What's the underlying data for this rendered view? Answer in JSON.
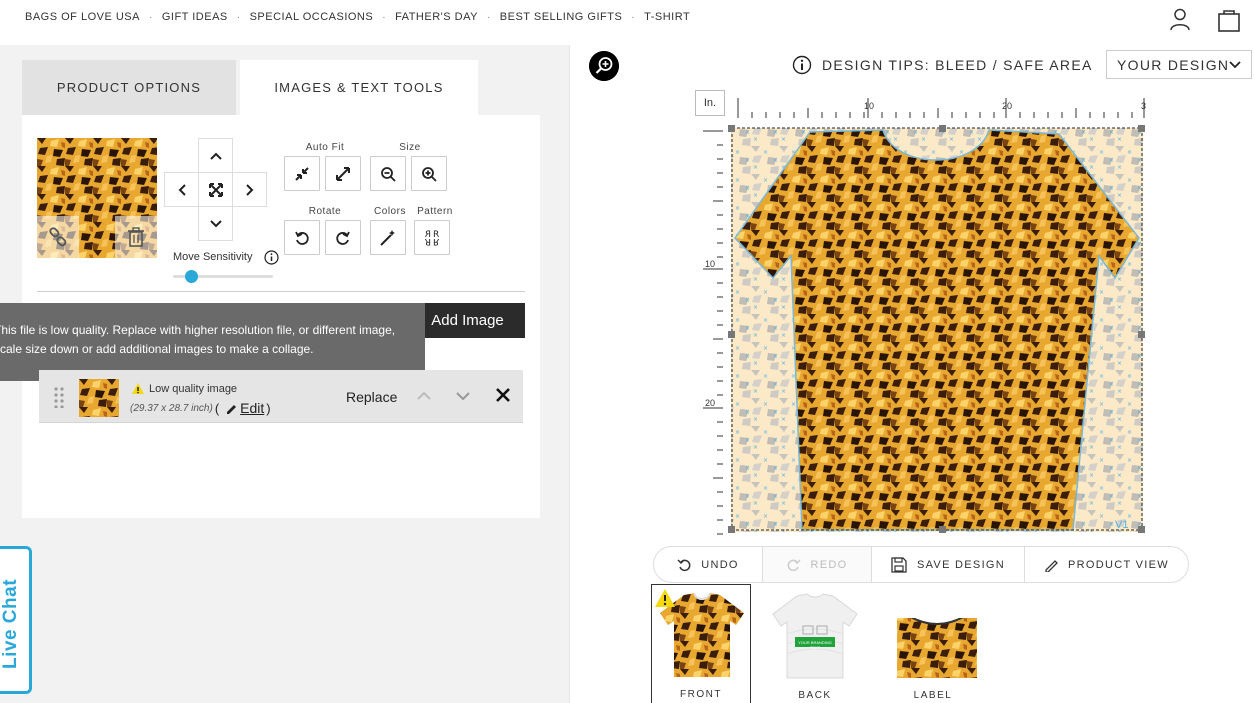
{
  "nav": {
    "links": [
      "BAGS OF LOVE USA",
      "GIFT IDEAS",
      "SPECIAL OCCASIONS",
      "FATHER'S DAY",
      "BEST SELLING GIFTS",
      "T-SHIRT"
    ],
    "separator": "·"
  },
  "tabs": {
    "product_options": "PRODUCT OPTIONS",
    "images_text_tools": "IMAGES & TEXT TOOLS"
  },
  "tools": {
    "auto_fit": "Auto Fit",
    "size": "Size",
    "rotate": "Rotate",
    "colors": "Colors",
    "pattern": "Pattern",
    "move_sensitivity": "Move Sensitivity",
    "move_sensitivity_level": 0.18
  },
  "add_image_label": "Add Image",
  "tooltip": {
    "line1": "This file is low quality. Replace with higher resolution file, or different image,",
    "line2": "scale size down or add additional images to make a collage."
  },
  "image_row": {
    "warning": "Low quality image",
    "dimensions": "(29.37 x 28.7 inch)",
    "paren_open": "(",
    "edit": "Edit",
    "paren_close": ")",
    "replace": "Replace"
  },
  "live_chat": "Live Chat",
  "design_tips": "DESIGN TIPS: BLEED / SAFE AREA",
  "your_design": "YOUR DESIGN",
  "ruler": {
    "unit": "In.",
    "top_ticks": [
      "10",
      "20",
      "3"
    ],
    "left_ticks": [
      "10",
      "20"
    ]
  },
  "canvas_badge": "V1",
  "actions": {
    "undo": "UNDO",
    "redo": "REDO",
    "save": "SAVE DESIGN",
    "product_view": "PRODUCT VIEW"
  },
  "views": {
    "front": "FRONT",
    "back": "BACK",
    "label": "LABEL",
    "back_tag_text": "YOUR BRANDING TEXT"
  },
  "colors": {
    "accent": "#2aa8d8",
    "dark_button": "#2b2b2b",
    "tooltip_bg": "#6a6a6a",
    "warning": "#f5d90a"
  }
}
